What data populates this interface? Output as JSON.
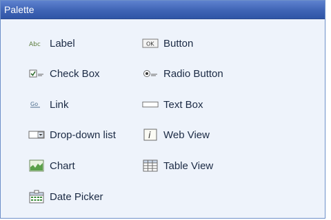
{
  "palette": {
    "title": "Palette",
    "items": [
      {
        "label": "Label",
        "icon": "label-icon"
      },
      {
        "label": "Button",
        "icon": "button-icon"
      },
      {
        "label": "Check Box",
        "icon": "checkbox-icon"
      },
      {
        "label": "Radio Button",
        "icon": "radio-button-icon"
      },
      {
        "label": "Link",
        "icon": "link-icon"
      },
      {
        "label": "Text Box",
        "icon": "textbox-icon"
      },
      {
        "label": "Drop-down list",
        "icon": "dropdown-icon"
      },
      {
        "label": "Web View",
        "icon": "web-view-icon"
      },
      {
        "label": "Chart",
        "icon": "chart-icon"
      },
      {
        "label": "Table View",
        "icon": "table-view-icon"
      },
      {
        "label": "Date Picker",
        "icon": "date-picker-icon"
      }
    ],
    "icon_text": {
      "label": "Abc",
      "button": "OK",
      "link": "Go",
      "web_view": "i"
    }
  }
}
